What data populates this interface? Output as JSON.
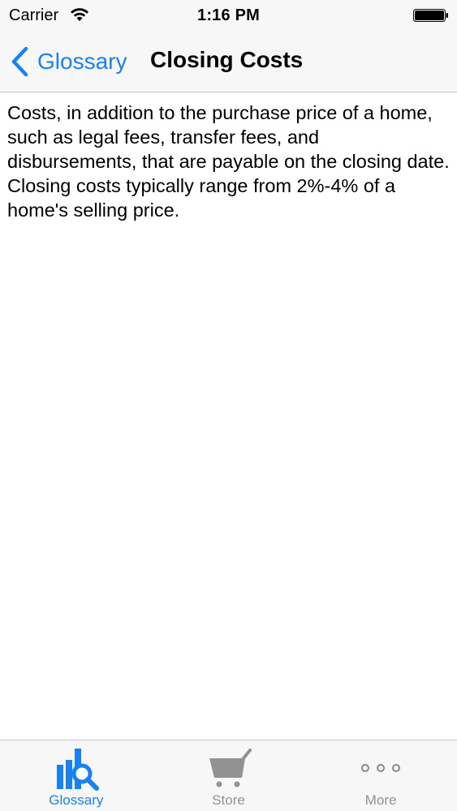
{
  "status_bar": {
    "carrier": "Carrier",
    "time": "1:16 PM"
  },
  "nav": {
    "back_label": "Glossary",
    "title": "Closing Costs"
  },
  "content": {
    "definition": "Costs, in addition to the purchase price of a home, such as legal fees, transfer fees, and disbursements, that are payable on the closing date. Closing costs typically range from 2%-4% of a home's selling price."
  },
  "tab_bar": {
    "tabs": [
      {
        "label": "Glossary",
        "icon": "glossary-icon",
        "active": true
      },
      {
        "label": "Store",
        "icon": "cart-icon",
        "active": false
      },
      {
        "label": "More",
        "icon": "more-icon",
        "active": false
      }
    ]
  },
  "colors": {
    "accent": "#1a82f0",
    "inactive": "#929292",
    "bar_background": "#f7f7f7"
  }
}
